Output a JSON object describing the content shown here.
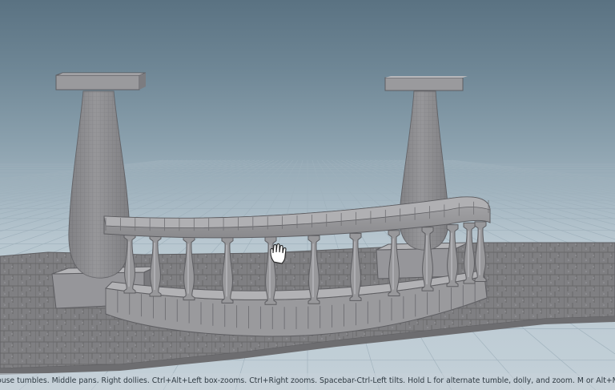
{
  "viewport": {
    "model": "balustrade-with-urns",
    "cursor": "hand-pan-icon",
    "background_top": "#5a7282",
    "background_bottom": "#c3d0d8",
    "grid_color": "#9fb1bc",
    "model_color": "#8e8e90"
  },
  "status_bar": {
    "text": "ouse tumbles. Middle pans. Right dollies. Ctrl+Alt+Left box-zooms. Ctrl+Right zooms. Spacebar-Ctrl-Left tilts. Hold L for alternate tumble, dolly, and zoom. M or Alt+M for First Person Navigation."
  }
}
